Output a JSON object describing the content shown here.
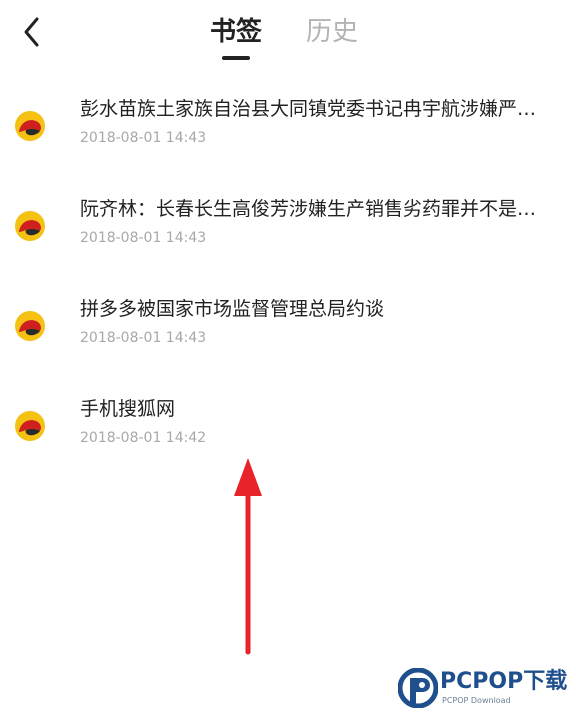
{
  "header": {
    "back_icon": "chevron-left-icon",
    "tabs": [
      {
        "label": "书签",
        "active": true
      },
      {
        "label": "历史",
        "active": false
      }
    ]
  },
  "bookmarks": [
    {
      "icon": "sohu-icon",
      "title": "彭水苗族土家族自治县大同镇党委书记冉宇航涉嫌严…",
      "time": "2018-08-01 14:43"
    },
    {
      "icon": "sohu-icon",
      "title": "阮齐林：长春长生高俊芳涉嫌生产销售劣药罪并不是…",
      "time": "2018-08-01 14:43"
    },
    {
      "icon": "sohu-icon",
      "title": "拼多多被国家市场监督管理总局约谈",
      "time": "2018-08-01 14:43"
    },
    {
      "icon": "sohu-icon",
      "title": "手机搜狐网",
      "time": "2018-08-01 14:42"
    }
  ],
  "watermark": {
    "logo_icon": "pcpop-logo-icon",
    "main": "PCPOP下载",
    "sub": "PCPOP Download"
  },
  "colors": {
    "active_tab": "#222222",
    "inactive_tab": "#b4b4b4",
    "arrow": "#e8232a",
    "icon_yellow": "#f5c214",
    "icon_red": "#cf1f1f",
    "watermark_blue": "#1f4f8c"
  }
}
